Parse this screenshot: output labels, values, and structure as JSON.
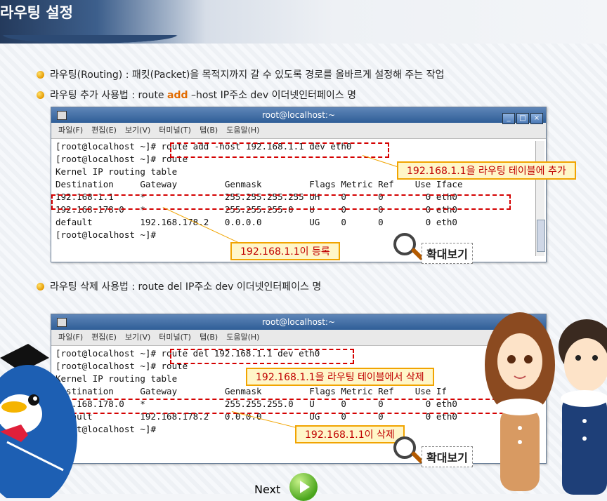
{
  "page_title": "라우팅 설정",
  "bullets": [
    "라우팅(Routing) : 패킷(Packet)을 목적지까지 갈 수 있도록 경로를 올바르게 설정해 주는 작업",
    "라우팅 삭제 사용법 :  route del IP주소 dev 이더넷인터페이스 명"
  ],
  "add_usage": {
    "before": "라우팅 추가 사용법 : route ",
    "keyword": "add",
    "after": " –host IP주소 dev 이더넷인터페이스 명"
  },
  "terminal1": {
    "title": "root@localhost:~",
    "menu": [
      "파일(F)",
      "편집(E)",
      "보기(V)",
      "터미널(T)",
      "탭(B)",
      "도움말(H)"
    ],
    "lines": [
      "[root@localhost ~]# route add -host 192.168.1.1 dev eth0",
      "[root@localhost ~]# route",
      "Kernel IP routing table",
      "Destination     Gateway         Genmask         Flags Metric Ref    Use Iface",
      "192.168.1.1     *               255.255.255.255 UH    0      0        0 eth0",
      "192.168.178.0   *               255.255.255.0   U     0      0        0 eth0",
      "default         192.168.178.2   0.0.0.0         UG    0      0        0 eth0",
      "[root@localhost ~]#"
    ]
  },
  "terminal2": {
    "title": "root@localhost:~",
    "menu": [
      "파일(F)",
      "편집(E)",
      "보기(V)",
      "터미널(T)",
      "탭(B)",
      "도움말(H)"
    ],
    "lines": [
      "[root@localhost ~]# route del 192.168.1.1 dev eth0",
      "[root@localhost ~]# route",
      "Kernel IP routing table",
      "Destination     Gateway         Genmask         Flags Metric Ref    Use If",
      "192.168.178.0   *               255.255.255.0   U     0      0        0 eth0",
      "default         192.168.178.2   0.0.0.0         UG    0      0        0 eth0",
      "[root@localhost ~]#"
    ]
  },
  "notes": {
    "add_table": "192.168.1.1을 라우팅 테이블에 추가",
    "registered": "192.168.1.1이 등록",
    "del_table": "192.168.1.1을 라우팅 테이블에서 삭제",
    "deleted": "192.168.1.1이 삭제"
  },
  "zoom_label": "확대보기",
  "next_label": "Next",
  "colors": {
    "accent": "#f1a400",
    "highlight": "#d40000",
    "keyword": "#e26b00"
  }
}
